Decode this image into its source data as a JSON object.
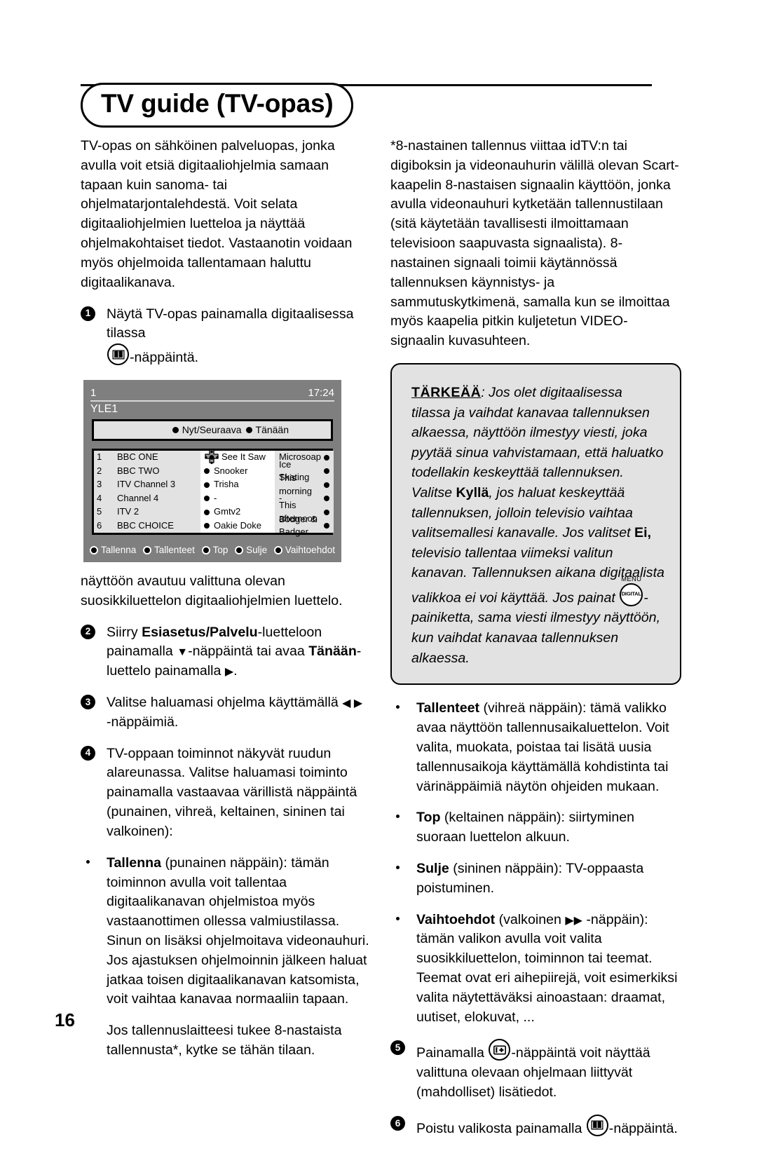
{
  "header": {
    "title": "TV guide (TV-opas)"
  },
  "page_number": "16",
  "left_column": {
    "intro": "TV-opas on sähköinen palveluopas, jonka avulla voit etsiä digitaaliohjelmia samaan tapaan kuin sanoma- tai ohjelmatarjontalehdestä. Voit selata digitaaliohjelmien luetteloa ja näyttää ohjelmakohtaiset tiedot. Vastaanotin voidaan myös ohjelmoida tallentamaan haluttu digitaalikanava.",
    "step1_a": "Näytä TV-opas painamalla digitaalisessa tilassa",
    "step1_b": "-näppäintä.",
    "after_screen": "näyttöön avautuu valittuna olevan suosikkiluettelon digitaaliohjelmien luettelo.",
    "step2_a": "Siirry ",
    "step2_bold1": "Esiasetus/Palvelu",
    "step2_b": "-luetteloon painamalla ",
    "step2_arrow_down": "▼",
    "step2_c": "-näppäintä tai avaa ",
    "step2_bold2": "Tänään",
    "step2_d": "-luettelo painamalla ",
    "step2_arrow_right": "▶",
    "step2_e": ".",
    "step3_a": "Valitse haluamasi ohjelma käyttämällä ",
    "step3_arrows": "◀ ▶",
    "step3_b": " -näppäimiä.",
    "step4": "TV-oppaan toiminnot näkyvät ruudun alareunassa. Valitse haluamasi toiminto painamalla vastaavaa värillistä näppäintä (punainen, vihreä, keltainen, sininen tai valkoinen):",
    "bullet_tallenna_bold": "Tallenna",
    "bullet_tallenna_rest": " (punainen näppäin): tämän toiminnon avulla voit tallentaa digitaalikanavan ohjelmistoa myös vastaanottimen ollessa valmiustilassa. Sinun on lisäksi ohjelmoitava videonauhuri. Jos ajastuksen ohjelmoinnin jälkeen haluat jatkaa toisen digitaalikanavan katsomista, voit vaihtaa kanavaa normaaliin tapaan.",
    "closing": "Jos tallennuslaitteesi tukee 8-nastaista tallennusta*, kytke se tähän tilaan."
  },
  "tv_screen": {
    "channel_number": "1",
    "time": "17:24",
    "channel_name": "YLE1",
    "tabs": [
      "Nyt/Seuraava",
      "Tänään"
    ],
    "rows": [
      {
        "no": "1",
        "channel": "BBC ONE",
        "now": "See It Saw",
        "next": "Microsoap"
      },
      {
        "no": "2",
        "channel": "BBC TWO",
        "now": "Snooker",
        "next": "Ice Skating"
      },
      {
        "no": "3",
        "channel": "ITV Channel 3",
        "now": "Trisha",
        "next": "This morning"
      },
      {
        "no": "4",
        "channel": "Channel 4",
        "now": "-",
        "next": "-"
      },
      {
        "no": "5",
        "channel": "ITV 2",
        "now": "Gmtv2",
        "next": "This afternoon"
      },
      {
        "no": "6",
        "channel": "BBC CHOICE",
        "now": "Oakie Doke",
        "next": "Bodger & Badger"
      }
    ],
    "footer_buttons": [
      "Tallenna",
      "Tallenteet",
      "Top",
      "Sulje",
      "Vaihtoehdot"
    ]
  },
  "right_column": {
    "footnote": "*8-nastainen tallennus viittaa idTV:n tai digiboksin ja videonauhurin välillä olevan Scart-kaapelin 8-nastaisen signaalin käyttöön, jonka avulla videonauhuri kytketään tallennustilaan (sitä käytetään tavallisesti ilmoittamaan televisioon saapuvasta signaalista). 8-nastainen signaali toimii käytännössä tallennuksen käynnistys- ja sammutuskytkimenä, samalla kun se ilmoittaa myös kaapelia pitkin kuljetetun VIDEO-signaalin kuvasuhteen.",
    "note": {
      "keyword": "TÄRKEÄÄ",
      "part1": ": Jos olet digitaalisessa tilassa ja vaihdat kanavaa tallennuksen alkaessa, näyttöön ilmestyy viesti, joka pyytää sinua vahvistamaan, että haluatko todellakin keskeyttää tallennuksen. Valitse ",
      "bold1": "Kyllä",
      "part2": ", jos haluat keskeyttää tallennuksen, jolloin televisio vaihtaa valitsemallesi kanavalle. Jos valitset ",
      "bold2": "Ei,",
      "part3": " televisio tallentaa viimeksi valitun kanavan. Tallennuksen aikana digitaalista valikkoa ei voi käyttää. Jos painat ",
      "menu_icon_top": "MENU",
      "menu_icon_label": "DIGITAL",
      "part4": "-painiketta, sama viesti ilmestyy näyttöön, kun vaihdat kanavaa tallennuksen alkaessa."
    },
    "bullet_tallenteet_bold": "Tallenteet",
    "bullet_tallenteet_rest": " (vihreä näppäin): tämä valikko avaa näyttöön tallennusaikaluettelon. Voit valita, muokata, poistaa tai lisätä uusia tallennusaikoja käyttämällä kohdistinta tai värinäppäimiä näytön ohjeiden mukaan.",
    "bullet_top_bold": "Top",
    "bullet_top_rest": " (keltainen näppäin): siirtyminen suoraan luettelon alkuun.",
    "bullet_sulje_bold": "Sulje",
    "bullet_sulje_rest": " (sininen näppäin):  TV-oppaasta poistuminen.",
    "bullet_vaihtoehdot_bold": "Vaihtoehdot",
    "bullet_vaihtoehdot_rest_a": " (valkoinen ",
    "bullet_vaihtoehdot_arrows": "▶▶",
    "bullet_vaihtoehdot_rest_b": " -näppäin): tämän valikon avulla voit valita suosikkiluettelon, toiminnon tai teemat. Teemat ovat eri aihepiirejä, voit esimerkiksi valita näytettäväksi ainoastaan: draamat, uutiset, elokuvat, ...",
    "step5_a": "Painamalla ",
    "step5_b": "-näppäintä voit näyttää valittuna olevaan ohjelmaan liittyvät (mahdolliset) lisätiedot.",
    "step6_a": "Poistu valikosta painamalla ",
    "step6_b": "-näppäintä."
  },
  "icons": {
    "guide_key": "book-icon",
    "info_key": "info-plus-icon",
    "menu_digital_key": "menu-digital-icon",
    "navpad": "dpad-icon"
  },
  "colors": {
    "tv_background": "#7f7f7f",
    "tv_panel": "#e2e2e2",
    "tv_panel_white": "#ffffff",
    "note_background": "#e2e2e2",
    "ink": "#000000"
  }
}
